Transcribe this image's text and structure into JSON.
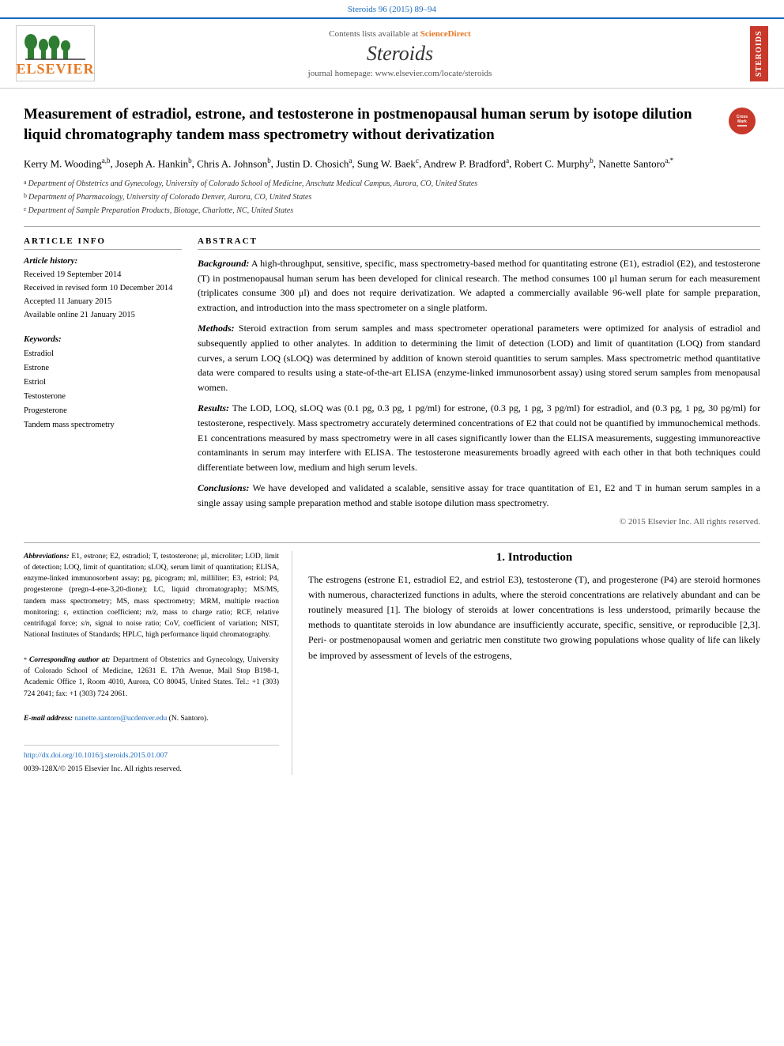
{
  "meta": {
    "journal_ref": "Steroids 96 (2015) 89–94",
    "top_link": "http://dx.doi.org/10.1016/j.steroids.2015.01.007"
  },
  "header": {
    "sciencedirect_label": "Contents lists available at",
    "sciencedirect_name": "ScienceDirect",
    "journal_title": "Steroids",
    "homepage_label": "journal homepage: www.elsevier.com/locate/steroids",
    "elsevier_label": "ELSEVIER",
    "steroids_side_label": "STEROIDS"
  },
  "article": {
    "title": "Measurement of estradiol, estrone, and testosterone in postmenopausal human serum by isotope dilution liquid chromatography tandem mass spectrometry without derivatization",
    "authors": "Kerry M. Wooding",
    "authors_full": "Kerry M. Wooding a,b, Joseph A. Hankin b, Chris A. Johnson b, Justin D. Chosich a, Sung W. Baek c, Andrew P. Bradford a, Robert C. Murphy b, Nanette Santoro a,*",
    "affiliations": [
      {
        "sup": "a",
        "text": "Department of Obstetrics and Gynecology, University of Colorado School of Medicine, Anschutz Medical Campus, Aurora, CO, United States"
      },
      {
        "sup": "b",
        "text": "Department of Pharmacology, University of Colorado Denver, Aurora, CO, United States"
      },
      {
        "sup": "c",
        "text": "Department of Sample Preparation Products, Biotage, Charlotte, NC, United States"
      }
    ]
  },
  "article_info": {
    "section_label": "Article  Info",
    "history_label": "Article history:",
    "received": "Received 19 September 2014",
    "revised": "Received in revised form 10 December 2014",
    "accepted": "Accepted 11 January 2015",
    "available": "Available online 21 January 2015",
    "keywords_label": "Keywords:",
    "keywords": [
      "Estradiol",
      "Estrone",
      "Estriol",
      "Testosterone",
      "Progesterone",
      "Tandem mass spectrometry"
    ]
  },
  "abstract": {
    "section_label": "Abstract",
    "background_label": "Background:",
    "background_text": "A high-throughput, sensitive, specific, mass spectrometry-based method for quantitating estrone (E1), estradiol (E2), and testosterone (T) in postmenopausal human serum has been developed for clinical research. The method consumes 100 μl human serum for each measurement (triplicates consume 300 μl) and does not require derivatization. We adapted a commercially available 96-well plate for sample preparation, extraction, and introduction into the mass spectrometer on a single platform.",
    "methods_label": "Methods:",
    "methods_text": "Steroid extraction from serum samples and mass spectrometer operational parameters were optimized for analysis of estradiol and subsequently applied to other analytes. In addition to determining the limit of detection (LOD) and limit of quantitation (LOQ) from standard curves, a serum LOQ (sLOQ) was determined by addition of known steroid quantities to serum samples. Mass spectrometric method quantitative data were compared to results using a state-of-the-art ELISA (enzyme-linked immunosorbent assay) using stored serum samples from menopausal women.",
    "results_label": "Results:",
    "results_text": "The LOD, LOQ, sLOQ was (0.1 pg, 0.3 pg, 1 pg/ml) for estrone, (0.3 pg, 1 pg, 3 pg/ml) for estradiol, and (0.3 pg, 1 pg, 30 pg/ml) for testosterone, respectively. Mass spectrometry accurately determined concentrations of E2 that could not be quantified by immunochemical methods. E1 concentrations measured by mass spectrometry were in all cases significantly lower than the ELISA measurements, suggesting immunoreactive contaminants in serum may interfere with ELISA. The testosterone measurements broadly agreed with each other in that both techniques could differentiate between low, medium and high serum levels.",
    "conclusions_label": "Conclusions:",
    "conclusions_text": "We have developed and validated a scalable, sensitive assay for trace quantitation of E1, E2 and T in human serum samples in a single assay using sample preparation method and stable isotope dilution mass spectrometry.",
    "copyright": "© 2015 Elsevier Inc. All rights reserved."
  },
  "introduction": {
    "section_number": "1.",
    "section_title": "Introduction",
    "paragraph": "The estrogens (estrone E1, estradiol E2, and estriol E3), testosterone (T), and progesterone (P4) are steroid hormones with numerous, characterized functions in adults, where the steroid concentrations are relatively abundant and can be routinely measured [1]. The biology of steroids at lower concentrations is less understood, primarily because the methods to quantitate steroids in low abundance are insufficiently accurate, specific, sensitive, or reproducible [2,3]. Peri- or postmenopausal women and geriatric men constitute two growing populations whose quality of life can likely be improved by assessment of levels of the estrogens,"
  },
  "footnotes": {
    "abbrev_label": "Abbreviations:",
    "abbrev_text": "E1, estrone; E2, estradiol; T, testosterone; μl, microliter; LOD, limit of detection; LOQ, limit of quantitation; sLOQ, serum limit of quantitation; ELISA, enzyme-linked immunosorbent assay; pg, picogram; ml, milliliter; E3, estriol; P4, progesterone (pregn-4-ene-3,20-dione); LC, liquid chromatography; MS/MS, tandem mass spectrometry; MS, mass spectrometry; MRM, multiple reaction monitoring; ε, extinction coefficient; m/z, mass to charge ratio; RCF, relative centrifugal force; s/n, signal to noise ratio; CoV, coefficient of variation; NIST, National Institutes of Standards; HPLC, high performance liquid chromatography.",
    "corr_label": "* Corresponding author at:",
    "corr_text": "Department of Obstetrics and Gynecology, University of Colorado School of Medicine, 12631 E. 17th Avenue, Mail Stop B198-1, Academic Office 1, Room 4010, Aurora, CO 80045, United States. Tel.: +1 (303) 724 2041; fax: +1 (303) 724 2061.",
    "email_label": "E-mail address:",
    "email_text": "nanette.santoro@ucdenver.edu (N. Santoro).",
    "doi_label": "http://dx.doi.org/10.1016/j.steroids.2015.01.007",
    "issn_text": "0039-128X/© 2015 Elsevier Inc. All rights reserved."
  }
}
